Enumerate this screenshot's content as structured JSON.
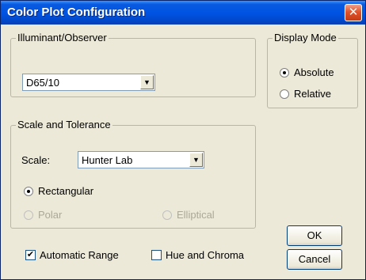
{
  "window": {
    "title": "Color Plot Configuration",
    "close_glyph": "✕"
  },
  "illuminant": {
    "group_label": "Illuminant/Observer",
    "selected": "D65/10",
    "arrow": "▼"
  },
  "display_mode": {
    "group_label": "Display Mode",
    "options": [
      {
        "label": "Absolute",
        "checked": true
      },
      {
        "label": "Relative",
        "checked": false
      }
    ]
  },
  "scale_tolerance": {
    "group_label": "Scale and Tolerance",
    "scale_label": "Scale:",
    "scale_selected": "Hunter Lab",
    "arrow": "▼",
    "options": [
      {
        "label": "Rectangular",
        "checked": true,
        "enabled": true
      },
      {
        "label": "Polar",
        "checked": false,
        "enabled": false
      },
      {
        "label": "Elliptical",
        "checked": false,
        "enabled": false
      }
    ]
  },
  "checkboxes": [
    {
      "label": "Automatic Range",
      "checked": true,
      "mark": "✔"
    },
    {
      "label": "Hue and Chroma",
      "checked": false,
      "mark": ""
    }
  ],
  "buttons": {
    "ok": "OK",
    "cancel": "Cancel"
  }
}
